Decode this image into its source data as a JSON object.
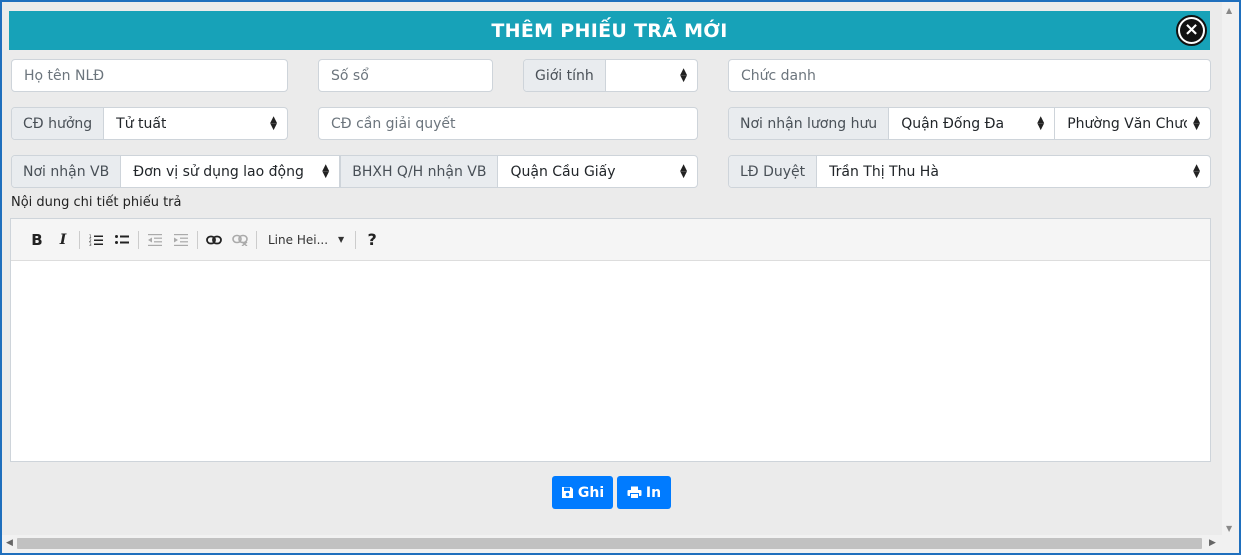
{
  "dialog": {
    "title": "THÊM PHIẾU TRẢ MỚI",
    "close_icon": "×"
  },
  "row1": {
    "name_placeholder": "Họ tên NLĐ",
    "book_placeholder": "Số sổ",
    "gender_label": "Giới tính",
    "gender_value": "",
    "title_placeholder": "Chức danh"
  },
  "row2": {
    "regime_label": "CĐ hưởng",
    "regime_value": "Tử tuất",
    "regime_needed_placeholder": "CĐ cần giải quyết",
    "pension_place_label": "Nơi nhận lương hưu",
    "district_value": "Quận Đống Đa",
    "ward_value": "Phường Văn Chương"
  },
  "row3": {
    "doc_place_label": "Nơi nhận VB",
    "doc_place_value": "Đơn vị sử dụng lao động",
    "bhxh_label": "BHXH Q/H nhận VB",
    "bhxh_value": "Quận Cầu Giấy",
    "approver_label": "LĐ Duyệt",
    "approver_value": "Trần Thị Thu Hà"
  },
  "editor": {
    "label": "Nội dung chi tiết phiếu trả",
    "line_height_label": "Line Hei...",
    "tools": [
      "bold-icon",
      "italic-icon",
      "ordered-list-icon",
      "unordered-list-icon",
      "outdent-icon",
      "indent-icon",
      "link-icon",
      "unlink-icon",
      "help-icon"
    ],
    "content": ""
  },
  "actions": {
    "save_label": "Ghi",
    "print_label": "In"
  },
  "colors": {
    "header": "#17a2b8",
    "primary": "#007bff",
    "background": "#ebebeb"
  }
}
